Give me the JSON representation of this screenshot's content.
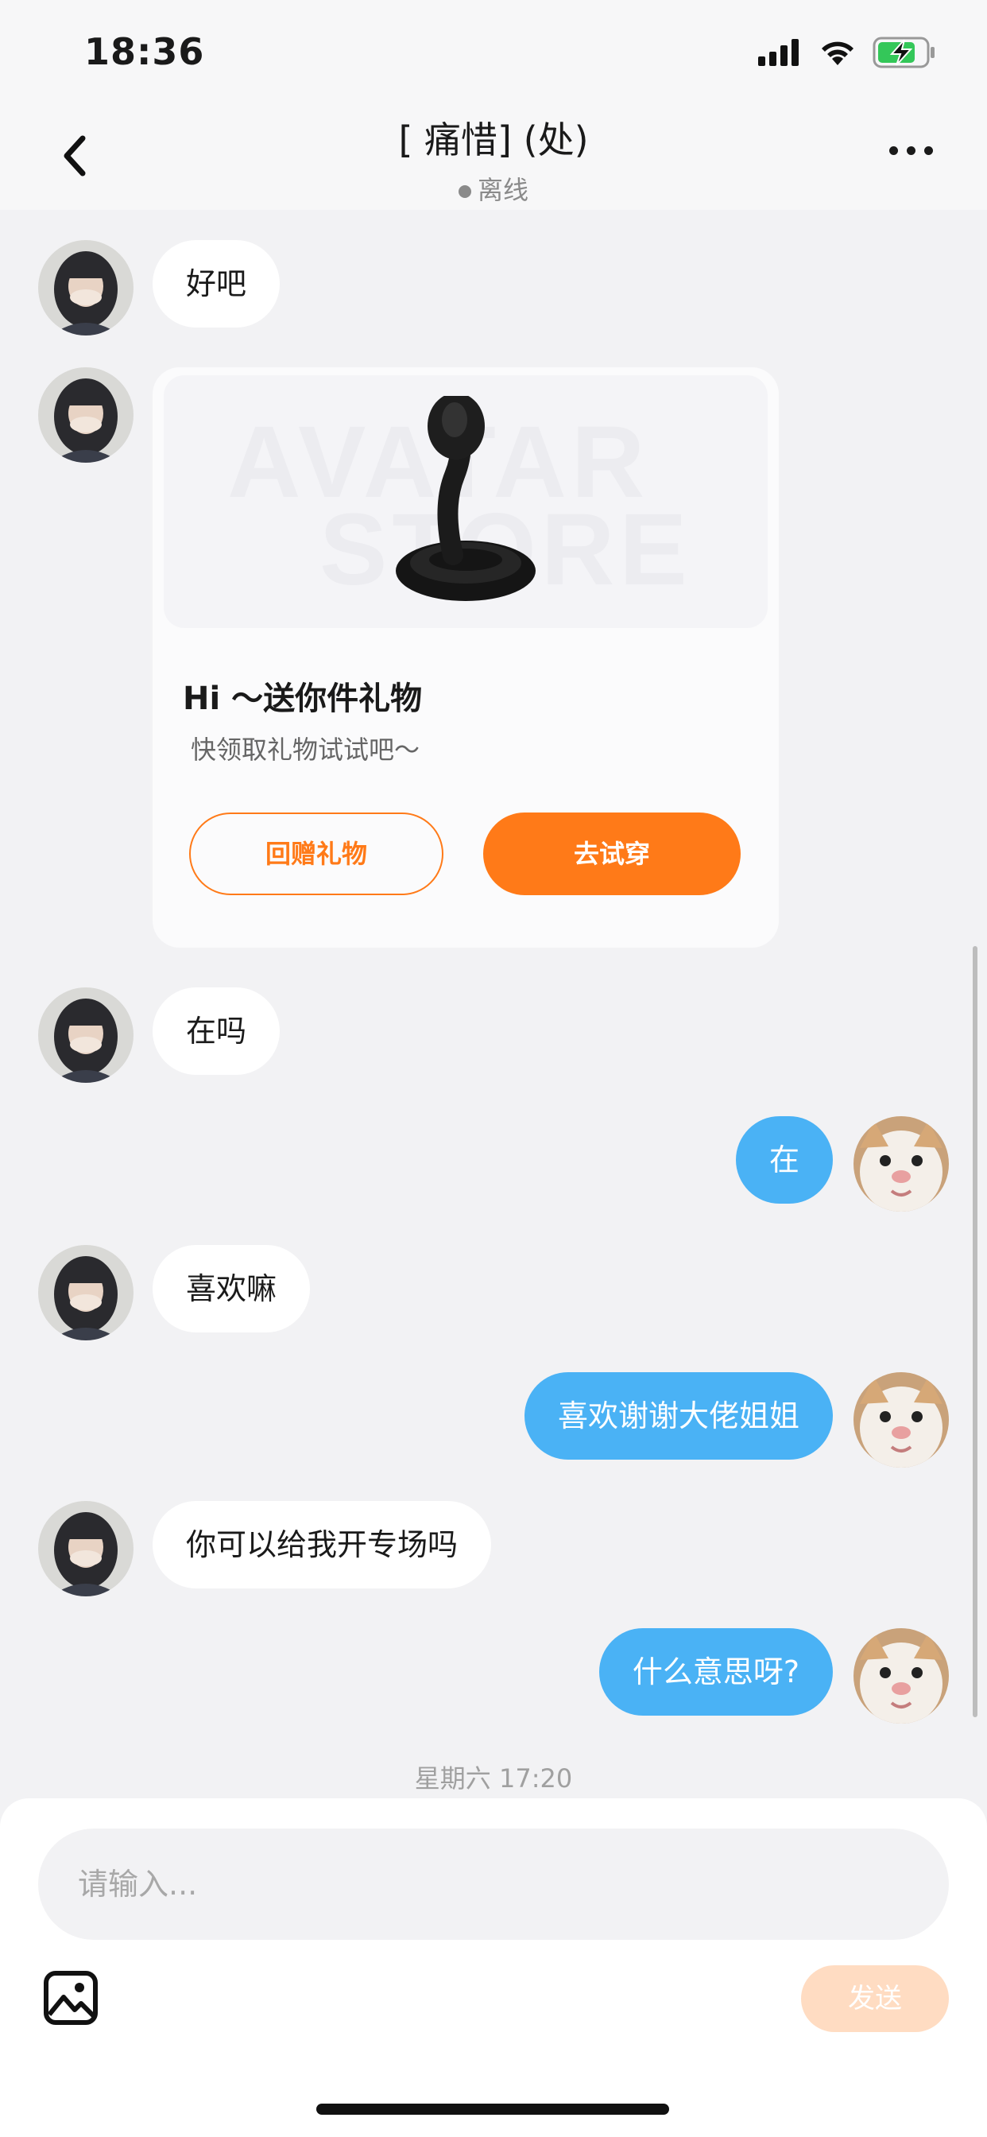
{
  "status_bar": {
    "time": "18:36"
  },
  "header": {
    "title": "[ 痛惜] (处)",
    "status": "离线"
  },
  "messages": [
    {
      "side": "in",
      "text": "好吧"
    },
    {
      "side": "in",
      "type": "gift_card"
    },
    {
      "side": "in",
      "text": "在吗"
    },
    {
      "side": "out",
      "text": "在"
    },
    {
      "side": "in",
      "text": "喜欢嘛"
    },
    {
      "side": "out",
      "text": "喜欢谢谢大佬姐姐"
    },
    {
      "side": "in",
      "text": "你可以给我开专场吗"
    },
    {
      "side": "out",
      "text": "什么意思呀?"
    }
  ],
  "gift_card": {
    "title": "Hi ～送你件礼物",
    "subtitle": "快领取礼物试试吧～",
    "return_label": "回赠礼物",
    "try_label": "去试穿",
    "watermark_line1": "AVATAR",
    "watermark_line2": "STORE"
  },
  "timestamp": "星期六 17:20",
  "composer": {
    "placeholder": "请输入...",
    "send_label": "发送"
  },
  "colors": {
    "accent_orange": "#ff7a18",
    "outgoing_bubble": "#4ab2f5",
    "send_disabled": "#ffdcc2"
  },
  "icons": {
    "back": "chevron-left-icon",
    "more": "more-icon",
    "image": "image-icon",
    "signal": "signal-icon",
    "wifi": "wifi-icon",
    "battery": "battery-charging-icon"
  }
}
